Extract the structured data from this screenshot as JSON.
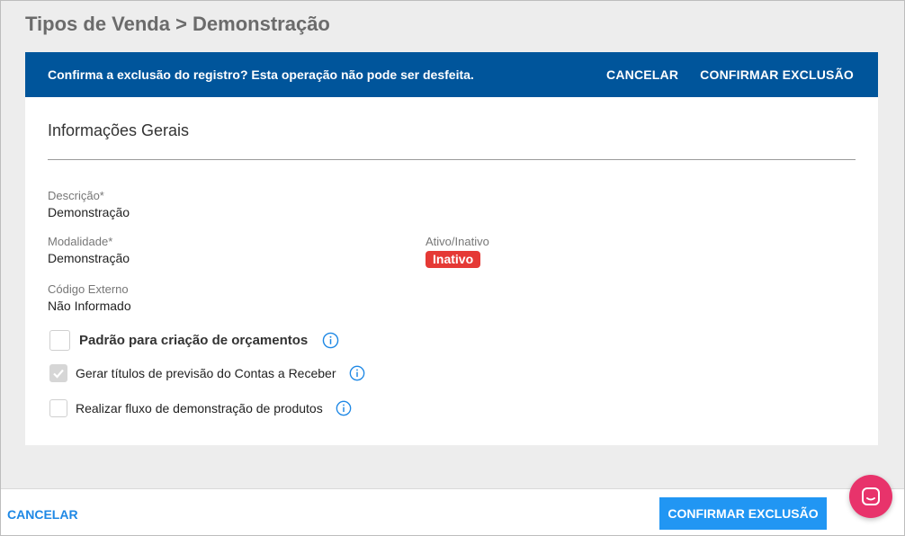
{
  "breadcrumb": "Tipos de Venda > Demonstração",
  "confirm_bar": {
    "message": "Confirma a exclusão do registro? Esta operação não pode ser desfeita.",
    "cancel": "CANCELAR",
    "confirm": "CONFIRMAR EXCLUSÃO"
  },
  "section": {
    "title": "Informações Gerais"
  },
  "fields": {
    "descricao": {
      "label": "Descrição*",
      "value": "Demonstração"
    },
    "modalidade": {
      "label": "Modalidade*",
      "value": "Demonstração"
    },
    "ativo": {
      "label": "Ativo/Inativo",
      "value": "Inativo"
    },
    "codigo": {
      "label": "Código Externo",
      "value": "Não Informado"
    }
  },
  "checkboxes": [
    {
      "label": "Padrão para criação de orçamentos",
      "checked": false
    },
    {
      "label": "Gerar títulos de previsão do Contas a Receber",
      "checked": true
    },
    {
      "label": "Realizar fluxo de demonstração de produtos",
      "checked": false
    }
  ],
  "footer": {
    "cancel": "CANCELAR",
    "confirm": "CONFIRMAR EXCLUSÃO"
  },
  "colors": {
    "confirm_bar": "#00559b",
    "badge_inactive": "#e53935",
    "primary": "#2196f3",
    "chat": "#e8336b"
  },
  "icons": {
    "info": "info-icon",
    "chat": "chat-icon",
    "check": "check-icon"
  }
}
